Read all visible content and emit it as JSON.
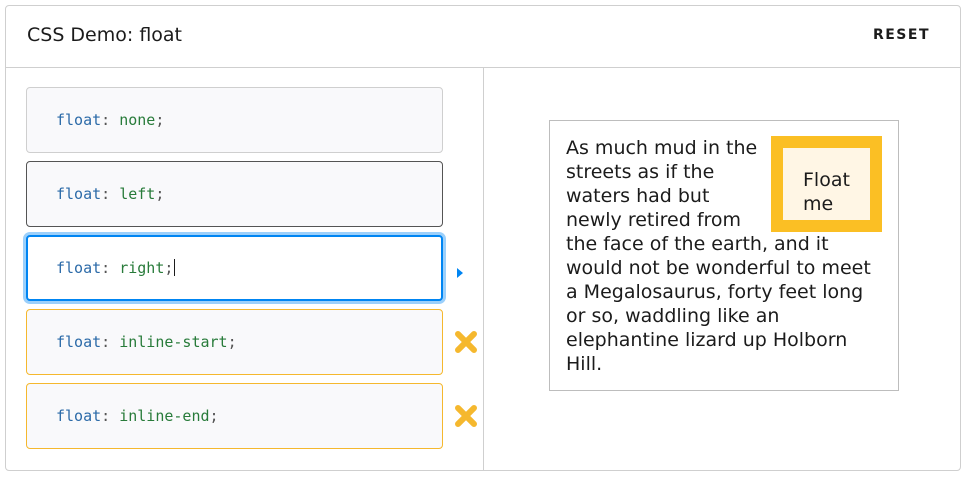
{
  "header": {
    "title": "CSS Demo: float",
    "reset_label": "RESET"
  },
  "choices": [
    {
      "prop": "float",
      "value": "none",
      "state": "default"
    },
    {
      "prop": "float",
      "value": "left",
      "state": "default-dark"
    },
    {
      "prop": "float",
      "value": "right",
      "state": "selected"
    },
    {
      "prop": "float",
      "value": "inline-start",
      "state": "unsupported"
    },
    {
      "prop": "float",
      "value": "inline-end",
      "state": "unsupported"
    }
  ],
  "punct": {
    "colon": ": ",
    "semicolon": ";"
  },
  "demo": {
    "float_label": "Float me",
    "text": "As much mud in the streets as if the waters had but newly retired from the face of the earth, and it would not be wonderful to meet a Megalosaurus, forty feet long or so, waddling like an elephantine lizard up Holborn Hill."
  },
  "colors": {
    "accent_blue": "#0085f2",
    "warning_yellow": "#f5b82e",
    "float_border": "#fbbf24",
    "float_bg": "#fff6e5"
  },
  "icons": {
    "selected_marker": "arrow-right-icon",
    "unsupported_marker": "x-icon"
  }
}
